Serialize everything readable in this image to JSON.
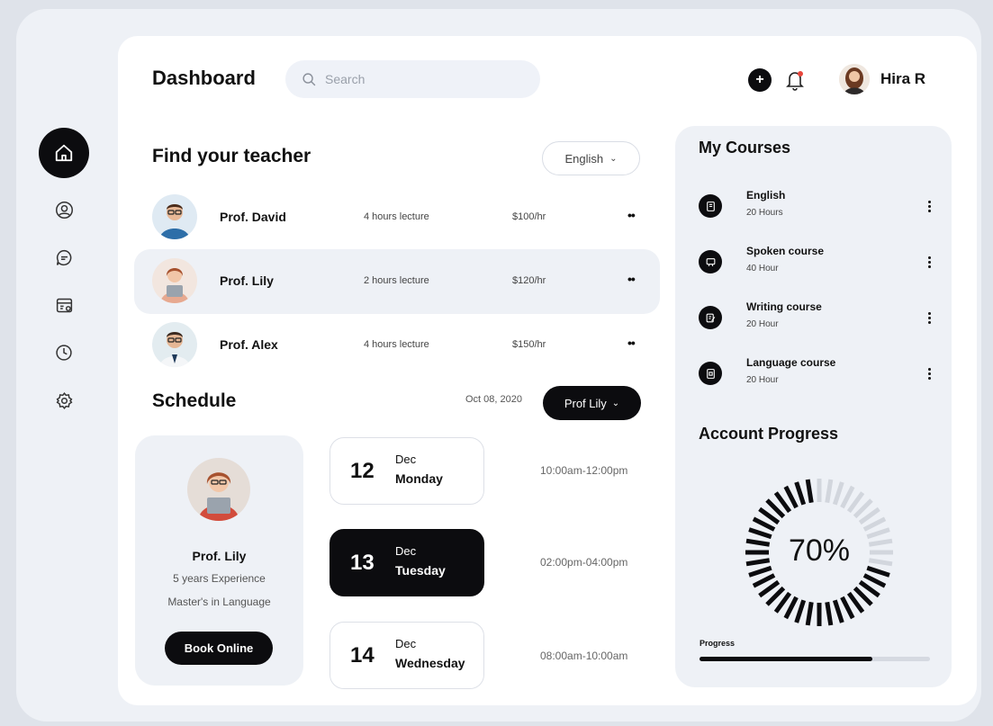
{
  "header": {
    "title": "Dashboard",
    "search_placeholder": "Search",
    "user_name": "Hira R"
  },
  "sidebar": {
    "items": [
      "home-icon",
      "profile-icon",
      "chat-icon",
      "calendar-icon",
      "clock-icon",
      "settings-icon"
    ],
    "active": "home"
  },
  "teachers": {
    "title": "Find your teacher",
    "language_filter": "English",
    "rows": [
      {
        "name": "Prof. David",
        "lecture": "4 hours lecture",
        "price": "$100/hr"
      },
      {
        "name": "Prof. Lily",
        "lecture": "2 hours lecture",
        "price": "$120/hr"
      },
      {
        "name": "Prof. Alex",
        "lecture": "4 hours lecture",
        "price": "$150/hr"
      }
    ]
  },
  "schedule": {
    "title": "Schedule",
    "date": "Oct 08, 2020",
    "teacher_filter": "Prof Lily",
    "profile": {
      "name": "Prof. Lily",
      "experience": "5 years Experience",
      "degree": "Master's in Language",
      "book_label": "Book Online"
    },
    "days": [
      {
        "num": "12",
        "month": "Dec",
        "day": "Monday",
        "time": "10:00am-12:00pm"
      },
      {
        "num": "13",
        "month": "Dec",
        "day": "Tuesday",
        "time": "02:00pm-04:00pm"
      },
      {
        "num": "14",
        "month": "Dec",
        "day": "Wednesday",
        "time": "08:00am-10:00am"
      }
    ]
  },
  "courses": {
    "title": "My Courses",
    "items": [
      {
        "name": "English",
        "hours": "20 Hours"
      },
      {
        "name": "Spoken course",
        "hours": "40 Hour"
      },
      {
        "name": "Writing course",
        "hours": "20 Hour"
      },
      {
        "name": "Language course",
        "hours": "20 Hour"
      }
    ]
  },
  "account_progress": {
    "title": "Account Progress",
    "percent_label": "70%",
    "percent": 70,
    "progress_label": "Progress",
    "bar_fraction": 0.75
  },
  "colors": {
    "accent": "#0c0c0f",
    "panel": "#ffffff",
    "card": "#eef1f6"
  }
}
